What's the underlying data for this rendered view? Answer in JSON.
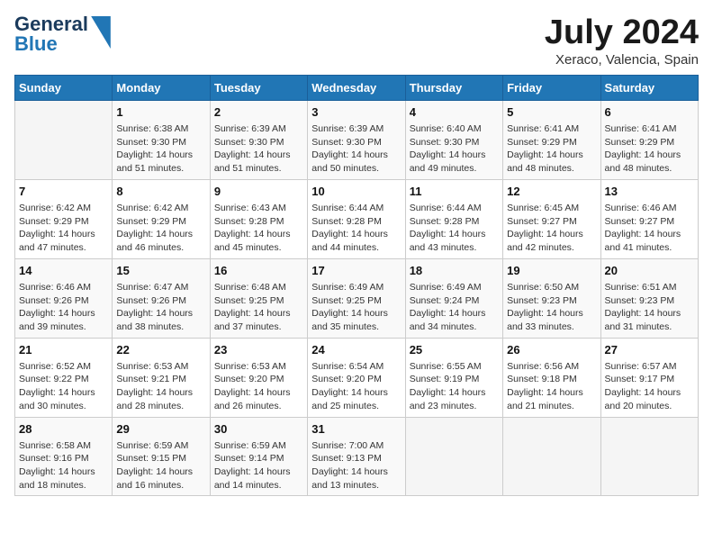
{
  "header": {
    "logo_line1": "General",
    "logo_line2": "Blue",
    "month_title": "July 2024",
    "location": "Xeraco, Valencia, Spain"
  },
  "weekdays": [
    "Sunday",
    "Monday",
    "Tuesday",
    "Wednesday",
    "Thursday",
    "Friday",
    "Saturday"
  ],
  "weeks": [
    [
      {
        "day": "",
        "sunrise": "",
        "sunset": "",
        "daylight": ""
      },
      {
        "day": "1",
        "sunrise": "Sunrise: 6:38 AM",
        "sunset": "Sunset: 9:30 PM",
        "daylight": "Daylight: 14 hours and 51 minutes."
      },
      {
        "day": "2",
        "sunrise": "Sunrise: 6:39 AM",
        "sunset": "Sunset: 9:30 PM",
        "daylight": "Daylight: 14 hours and 51 minutes."
      },
      {
        "day": "3",
        "sunrise": "Sunrise: 6:39 AM",
        "sunset": "Sunset: 9:30 PM",
        "daylight": "Daylight: 14 hours and 50 minutes."
      },
      {
        "day": "4",
        "sunrise": "Sunrise: 6:40 AM",
        "sunset": "Sunset: 9:30 PM",
        "daylight": "Daylight: 14 hours and 49 minutes."
      },
      {
        "day": "5",
        "sunrise": "Sunrise: 6:41 AM",
        "sunset": "Sunset: 9:29 PM",
        "daylight": "Daylight: 14 hours and 48 minutes."
      },
      {
        "day": "6",
        "sunrise": "Sunrise: 6:41 AM",
        "sunset": "Sunset: 9:29 PM",
        "daylight": "Daylight: 14 hours and 48 minutes."
      }
    ],
    [
      {
        "day": "7",
        "sunrise": "Sunrise: 6:42 AM",
        "sunset": "Sunset: 9:29 PM",
        "daylight": "Daylight: 14 hours and 47 minutes."
      },
      {
        "day": "8",
        "sunrise": "Sunrise: 6:42 AM",
        "sunset": "Sunset: 9:29 PM",
        "daylight": "Daylight: 14 hours and 46 minutes."
      },
      {
        "day": "9",
        "sunrise": "Sunrise: 6:43 AM",
        "sunset": "Sunset: 9:28 PM",
        "daylight": "Daylight: 14 hours and 45 minutes."
      },
      {
        "day": "10",
        "sunrise": "Sunrise: 6:44 AM",
        "sunset": "Sunset: 9:28 PM",
        "daylight": "Daylight: 14 hours and 44 minutes."
      },
      {
        "day": "11",
        "sunrise": "Sunrise: 6:44 AM",
        "sunset": "Sunset: 9:28 PM",
        "daylight": "Daylight: 14 hours and 43 minutes."
      },
      {
        "day": "12",
        "sunrise": "Sunrise: 6:45 AM",
        "sunset": "Sunset: 9:27 PM",
        "daylight": "Daylight: 14 hours and 42 minutes."
      },
      {
        "day": "13",
        "sunrise": "Sunrise: 6:46 AM",
        "sunset": "Sunset: 9:27 PM",
        "daylight": "Daylight: 14 hours and 41 minutes."
      }
    ],
    [
      {
        "day": "14",
        "sunrise": "Sunrise: 6:46 AM",
        "sunset": "Sunset: 9:26 PM",
        "daylight": "Daylight: 14 hours and 39 minutes."
      },
      {
        "day": "15",
        "sunrise": "Sunrise: 6:47 AM",
        "sunset": "Sunset: 9:26 PM",
        "daylight": "Daylight: 14 hours and 38 minutes."
      },
      {
        "day": "16",
        "sunrise": "Sunrise: 6:48 AM",
        "sunset": "Sunset: 9:25 PM",
        "daylight": "Daylight: 14 hours and 37 minutes."
      },
      {
        "day": "17",
        "sunrise": "Sunrise: 6:49 AM",
        "sunset": "Sunset: 9:25 PM",
        "daylight": "Daylight: 14 hours and 35 minutes."
      },
      {
        "day": "18",
        "sunrise": "Sunrise: 6:49 AM",
        "sunset": "Sunset: 9:24 PM",
        "daylight": "Daylight: 14 hours and 34 minutes."
      },
      {
        "day": "19",
        "sunrise": "Sunrise: 6:50 AM",
        "sunset": "Sunset: 9:23 PM",
        "daylight": "Daylight: 14 hours and 33 minutes."
      },
      {
        "day": "20",
        "sunrise": "Sunrise: 6:51 AM",
        "sunset": "Sunset: 9:23 PM",
        "daylight": "Daylight: 14 hours and 31 minutes."
      }
    ],
    [
      {
        "day": "21",
        "sunrise": "Sunrise: 6:52 AM",
        "sunset": "Sunset: 9:22 PM",
        "daylight": "Daylight: 14 hours and 30 minutes."
      },
      {
        "day": "22",
        "sunrise": "Sunrise: 6:53 AM",
        "sunset": "Sunset: 9:21 PM",
        "daylight": "Daylight: 14 hours and 28 minutes."
      },
      {
        "day": "23",
        "sunrise": "Sunrise: 6:53 AM",
        "sunset": "Sunset: 9:20 PM",
        "daylight": "Daylight: 14 hours and 26 minutes."
      },
      {
        "day": "24",
        "sunrise": "Sunrise: 6:54 AM",
        "sunset": "Sunset: 9:20 PM",
        "daylight": "Daylight: 14 hours and 25 minutes."
      },
      {
        "day": "25",
        "sunrise": "Sunrise: 6:55 AM",
        "sunset": "Sunset: 9:19 PM",
        "daylight": "Daylight: 14 hours and 23 minutes."
      },
      {
        "day": "26",
        "sunrise": "Sunrise: 6:56 AM",
        "sunset": "Sunset: 9:18 PM",
        "daylight": "Daylight: 14 hours and 21 minutes."
      },
      {
        "day": "27",
        "sunrise": "Sunrise: 6:57 AM",
        "sunset": "Sunset: 9:17 PM",
        "daylight": "Daylight: 14 hours and 20 minutes."
      }
    ],
    [
      {
        "day": "28",
        "sunrise": "Sunrise: 6:58 AM",
        "sunset": "Sunset: 9:16 PM",
        "daylight": "Daylight: 14 hours and 18 minutes."
      },
      {
        "day": "29",
        "sunrise": "Sunrise: 6:59 AM",
        "sunset": "Sunset: 9:15 PM",
        "daylight": "Daylight: 14 hours and 16 minutes."
      },
      {
        "day": "30",
        "sunrise": "Sunrise: 6:59 AM",
        "sunset": "Sunset: 9:14 PM",
        "daylight": "Daylight: 14 hours and 14 minutes."
      },
      {
        "day": "31",
        "sunrise": "Sunrise: 7:00 AM",
        "sunset": "Sunset: 9:13 PM",
        "daylight": "Daylight: 14 hours and 13 minutes."
      },
      {
        "day": "",
        "sunrise": "",
        "sunset": "",
        "daylight": ""
      },
      {
        "day": "",
        "sunrise": "",
        "sunset": "",
        "daylight": ""
      },
      {
        "day": "",
        "sunrise": "",
        "sunset": "",
        "daylight": ""
      }
    ]
  ]
}
